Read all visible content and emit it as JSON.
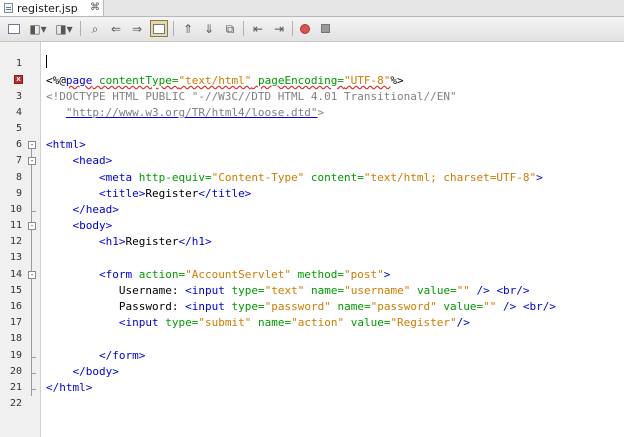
{
  "tab": {
    "title": "register.jsp",
    "close_glyph": "⌘"
  },
  "toolbar": {
    "buttons": [
      {
        "icon": "last-edit-icon"
      },
      {
        "icon": "back-icon"
      },
      {
        "icon": "forward-icon"
      },
      {
        "icon": "find-selection-icon"
      },
      {
        "icon": "find-previous-icon"
      },
      {
        "icon": "find-next-icon"
      },
      {
        "icon": "toggle-highlight-icon"
      },
      {
        "icon": "previous-bookmark-icon"
      },
      {
        "icon": "next-bookmark-icon"
      },
      {
        "icon": "toggle-bookmark-icon"
      },
      {
        "icon": "shift-left-icon"
      },
      {
        "icon": "shift-right-icon"
      },
      {
        "icon": "start-macro-icon"
      },
      {
        "icon": "stop-macro-icon"
      }
    ]
  },
  "gutter": {
    "line_numbers": [
      "1",
      "2",
      "3",
      "4",
      "5",
      "6",
      "7",
      "8",
      "9",
      "10",
      "11",
      "12",
      "13",
      "14",
      "15",
      "16",
      "17",
      "18",
      "19",
      "20",
      "21",
      "22"
    ],
    "error_marker": "x"
  },
  "code": {
    "l2": {
      "a": "<%@",
      "b": "page",
      "c": " contentType=",
      "d": "\"text/html\"",
      "e": " pageEncoding=",
      "f": "\"UTF-8\"",
      "g": "%>"
    },
    "l3": {
      "a": "<!DOCTYPE HTML PUBLIC \"-//W3C//DTD HTML 4.01 Transitional//EN\""
    },
    "l4": {
      "a": "   ",
      "b": "\"http://www.w3.org/TR/html4/loose.dtd\"",
      "c": ">"
    },
    "l6": {
      "a": "<html>"
    },
    "l7": {
      "a": "    ",
      "b": "<head>"
    },
    "l8": {
      "a": "        ",
      "b": "<meta",
      "c": " http-equiv=",
      "d": "\"Content-Type\"",
      "e": " content=",
      "f": "\"text/html; charset=UTF-8\"",
      "g": ">"
    },
    "l9": {
      "a": "        ",
      "b": "<title>",
      "c": "Register",
      "d": "</title>"
    },
    "l10": {
      "a": "    ",
      "b": "</head>"
    },
    "l11": {
      "a": "    ",
      "b": "<body>"
    },
    "l12": {
      "a": "        ",
      "b": "<h1>",
      "c": "Register",
      "d": "</h1>"
    },
    "l14": {
      "a": "        ",
      "b": "<form",
      "c": " action=",
      "d": "\"AccountServlet\"",
      "e": " method=",
      "f": "\"post\"",
      "g": ">"
    },
    "l15": {
      "a": "           ",
      "b": "Username: ",
      "c": "<input",
      "d": " type=",
      "e": "\"text\"",
      "f": " name=",
      "g": "\"username\"",
      "h": " value=",
      "i": "\"\"",
      "j": " /> ",
      "k": "<br/>"
    },
    "l16": {
      "a": "           ",
      "b": "Password: ",
      "c": "<input",
      "d": " type=",
      "e": "\"password\"",
      "f": " name=",
      "g": "\"password\"",
      "h": " value=",
      "i": "\"\"",
      "j": " /> ",
      "k": "<br/>"
    },
    "l17": {
      "a": "           ",
      "b": "<input",
      "c": " type=",
      "d": "\"submit\"",
      "e": " name=",
      "f": "\"action\"",
      "g": " value=",
      "h": "\"Register\"",
      "i": "/>"
    },
    "l19": {
      "a": "        ",
      "b": "</form>"
    },
    "l20": {
      "a": "    ",
      "b": "</body>"
    },
    "l21": {
      "a": "</html>"
    }
  },
  "colors": {
    "tag": "#0000e6",
    "attribute": "#009900",
    "value": "#ce7b00",
    "doctype": "#808080",
    "error": "#c62828"
  }
}
